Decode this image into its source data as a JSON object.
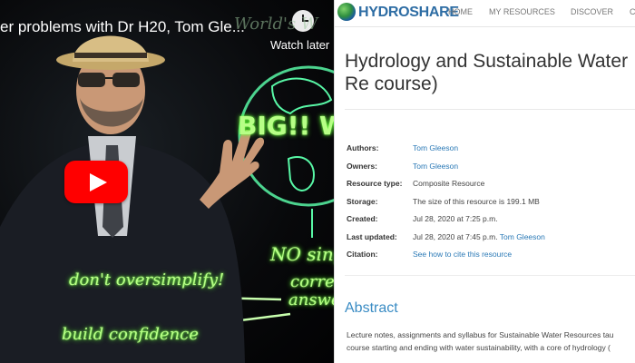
{
  "video": {
    "title": "er problems with Dr H20, Tom Gle...",
    "watch_later": "Watch later",
    "scribbles": {
      "worlds": "World's W",
      "big": "BIG!! W",
      "no_single": "NO sing",
      "correct": "correc",
      "answer": "answe",
      "dont_oversimplify": "don't oversimplify!",
      "build_confidence": "build confidence"
    },
    "colors": {
      "youtube_red": "#ff0000",
      "glow_green": "#b7ff86"
    }
  },
  "hydroshare": {
    "logo": "HYDROSHARE",
    "nav": {
      "home": "HOME",
      "my_resources": "MY RESOURCES",
      "discover": "DISCOVER",
      "more": "C"
    },
    "title": "Hydrology and Sustainable Water Re course)",
    "meta": {
      "authors_label": "Authors:",
      "authors_value": "Tom Gleeson",
      "owners_label": "Owners:",
      "owners_value": "Tom Gleeson",
      "type_label": "Resource type:",
      "type_value": "Composite Resource",
      "storage_label": "Storage:",
      "storage_value": "The size of this resource is 199.1 MB",
      "created_label": "Created:",
      "created_value": "Jul 28, 2020 at 7:25 p.m.",
      "updated_label": "Last updated:",
      "updated_value": "Jul 28, 2020 at 7:45 p.m.",
      "updated_by": "Tom Gleeson",
      "citation_label": "Citation:",
      "citation_value": "See how to cite this resource"
    },
    "abstract_heading": "Abstract",
    "abstract_line1": "Lecture notes, assignments and syllabus for Sustainable Water Resources tau",
    "abstract_line2": "course starting and ending with water sustainability, with a core of hydrology (",
    "colors": {
      "link": "#2a79b6",
      "heading": "#3a8cc4"
    }
  }
}
